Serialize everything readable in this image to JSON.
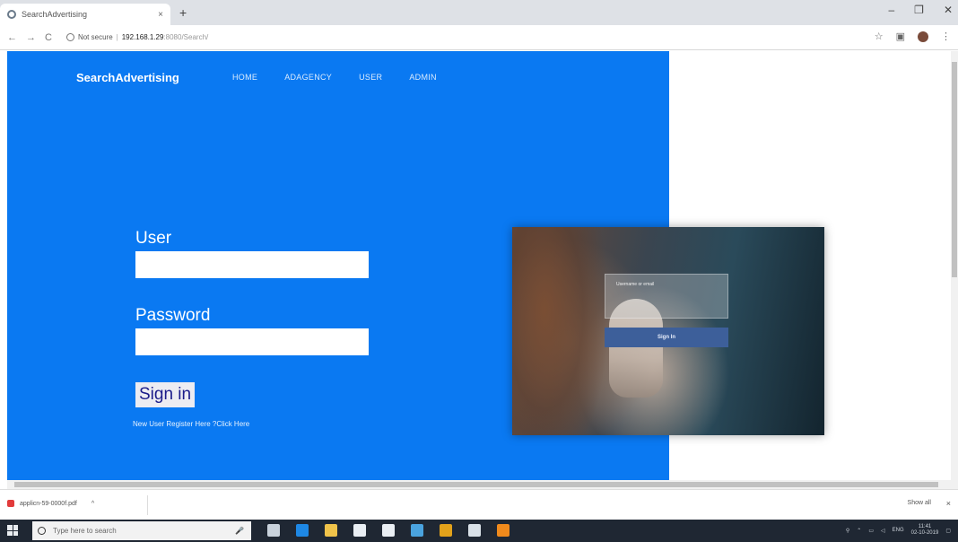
{
  "browser": {
    "tab_title": "SearchAdvertising",
    "tab_close": "×",
    "new_tab": "+",
    "window_minimize": "–",
    "window_maximize": "❐",
    "window_close": "✕",
    "nav_back": "←",
    "nav_forward": "→",
    "nav_reload": "C",
    "security_text": "Not secure",
    "url_host": "192.168.1.29",
    "url_path": ":8080/Search/",
    "bookmark_star": "☆"
  },
  "page": {
    "brand": "SearchAdvertising",
    "nav": [
      "HOME",
      "ADAGENCY",
      "USER",
      "ADMIN"
    ],
    "form": {
      "user_label": "User",
      "user_value": "",
      "password_label": "Password",
      "password_value": "",
      "signin_label": "Sign in",
      "register_text": "New User Register Here ?Click Here"
    },
    "image_overlay": {
      "input_text": "Username or email",
      "button_text": "Sign In"
    }
  },
  "downloads": {
    "file_name": "applicn-59-0000f.pdf",
    "file_menu": "^",
    "show_all": "Show all",
    "close": "×"
  },
  "taskbar": {
    "search_placeholder": "Type here to search",
    "language": "ENG",
    "time": "11:41",
    "date": "02-10-2019",
    "icons": [
      {
        "name": "task-view-icon",
        "color": "#c9d2dc"
      },
      {
        "name": "edge-icon",
        "color": "#1e88e5"
      },
      {
        "name": "file-explorer-icon",
        "color": "#f0c34a"
      },
      {
        "name": "store-icon",
        "color": "#e9eef3"
      },
      {
        "name": "mail-icon",
        "color": "#e9eef3"
      },
      {
        "name": "app-icon",
        "color": "#4aa3df"
      },
      {
        "name": "chrome-icon",
        "color": "#e2a21b"
      },
      {
        "name": "notepad-icon",
        "color": "#d9e1e8"
      },
      {
        "name": "vlc-icon",
        "color": "#f08a1c"
      }
    ]
  },
  "colors": {
    "page_blue": "#0a79f2",
    "signin_text": "#1b1c8a"
  }
}
